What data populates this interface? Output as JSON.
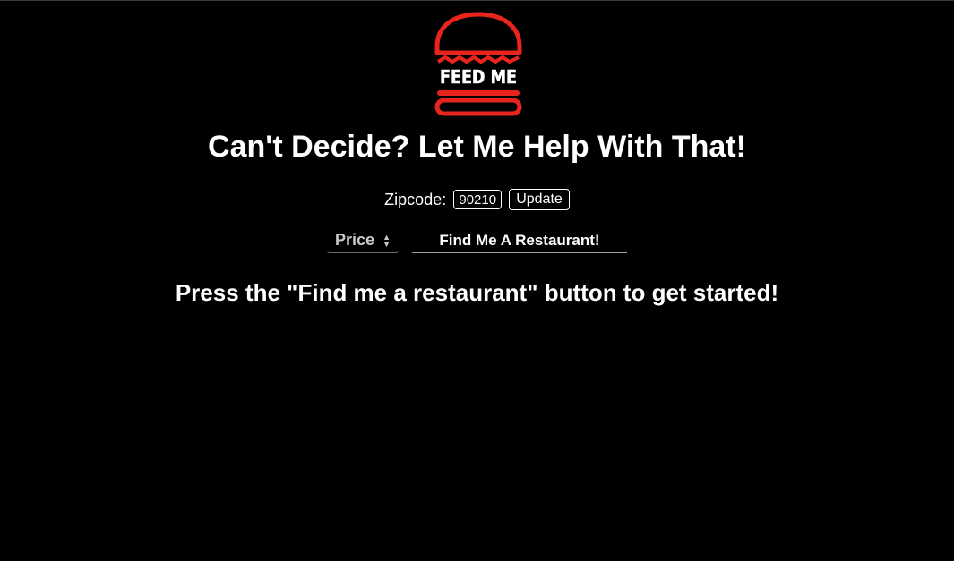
{
  "logo": {
    "text": "FEED ME",
    "icon": "burger-icon",
    "color": "#e8241f"
  },
  "headline": "Can't Decide? Let Me Help With That!",
  "zipcode": {
    "label": "Zipcode:",
    "value": "90210",
    "update_label": "Update"
  },
  "controls": {
    "price_label": "Price",
    "price_icon": "sort-arrows-icon",
    "find_label": "Find Me A Restaurant!"
  },
  "prompt": "Press the \"Find me a restaurant\" button to get started!",
  "colors": {
    "background": "#000000",
    "text": "#ffffff",
    "accent": "#e8241f"
  }
}
